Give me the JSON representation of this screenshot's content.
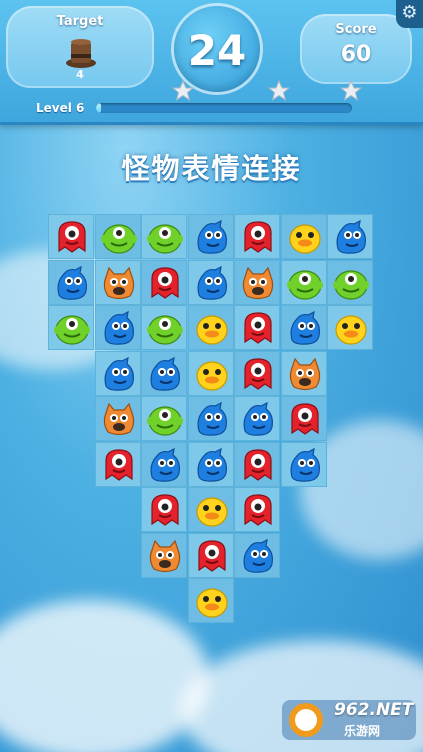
{
  "hud": {
    "target_label": "Target",
    "target_icon": "top-hat-icon",
    "target_count": "4",
    "moves_left": "24",
    "score_label": "Score",
    "score_value": "60",
    "level_label": "Level 6",
    "progress": 0.02,
    "stars": [
      "star-icon",
      "star-icon",
      "star-icon"
    ]
  },
  "heading": "怪物表情连接",
  "board": {
    "rows": [
      [
        "red",
        "green",
        "green",
        "blue",
        "red",
        "yellow",
        "blue"
      ],
      [
        "blue",
        "orange",
        "red",
        "blue",
        "orange",
        "green",
        "green"
      ],
      [
        "green",
        "blue",
        "green",
        "yellow",
        "red",
        "blue",
        "yellow"
      ],
      [
        null,
        "blue",
        "blue",
        "yellow",
        "red",
        "orange",
        null
      ],
      [
        null,
        "orange",
        "green",
        "blue",
        "blue",
        "red",
        null
      ],
      [
        null,
        "red",
        "blue",
        "blue",
        "red",
        "blue",
        null
      ],
      [
        null,
        null,
        "red",
        "yellow",
        "red",
        null,
        null
      ],
      [
        null,
        null,
        "orange",
        "red",
        "blue",
        null,
        null
      ],
      [
        null,
        null,
        null,
        "yellow",
        null,
        null,
        null
      ]
    ]
  },
  "colors": {
    "red": "#e4222c",
    "green": "#6fd12a",
    "blue": "#1f7fe0",
    "yellow": "#ffd21c",
    "orange": "#f08a32"
  },
  "watermark": {
    "text": "962.NET",
    "sub": "乐游网"
  }
}
